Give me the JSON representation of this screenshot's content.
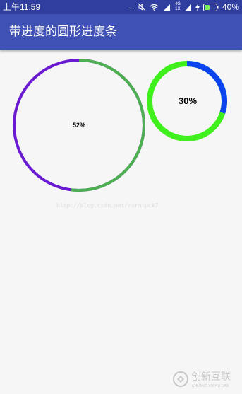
{
  "status_bar": {
    "time": "上午11:59",
    "dots": "...",
    "network": "4G 1X",
    "battery_percent": "40%",
    "background_color": "#303f9f"
  },
  "app_bar": {
    "title": "带进度的圆形进度条",
    "background_color": "#3f51b5"
  },
  "progress_rings": [
    {
      "name": "large-ring",
      "label": "52%",
      "progress": 0.52,
      "progress_color": "#4caf50",
      "track_color": "#6a1bd1"
    },
    {
      "name": "small-ring",
      "label": "30%",
      "progress": 0.3,
      "progress_color": "#0c44f0",
      "track_color": "#3ff01c"
    }
  ],
  "watermark": {
    "url": "http://blog.csdn.net/rorntuck7",
    "brand_name": "创新互联",
    "brand_sub": "CHUANG XIN HU LIAN"
  }
}
